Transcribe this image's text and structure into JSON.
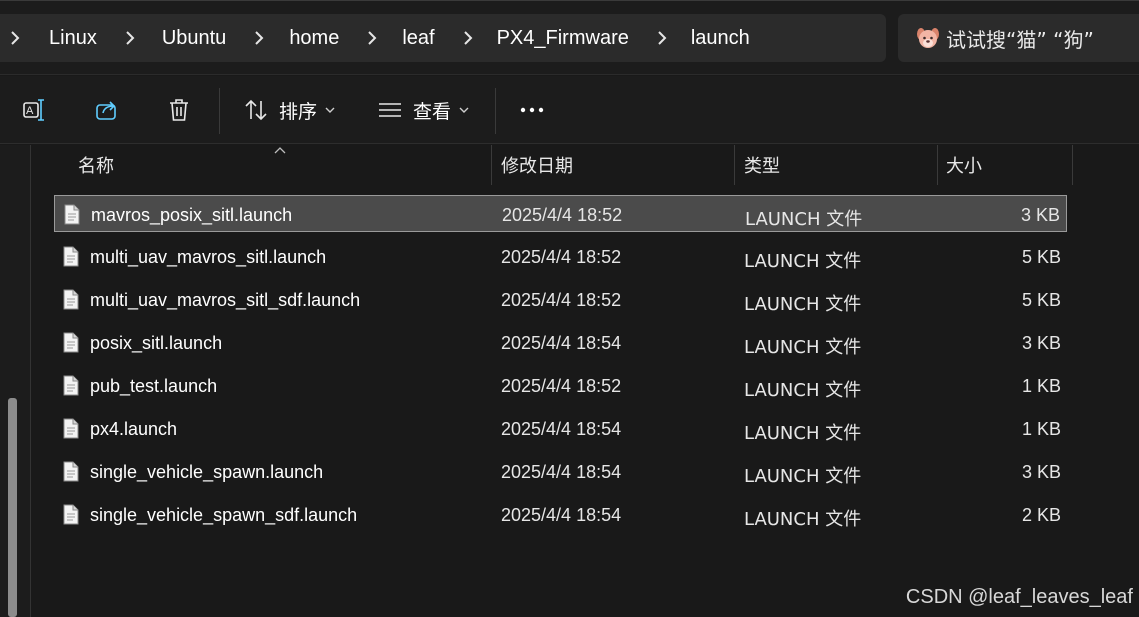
{
  "breadcrumb": {
    "items": [
      "Linux",
      "Ubuntu",
      "home",
      "leaf",
      "PX4_Firmware",
      "launch"
    ]
  },
  "search": {
    "placeholder": "试试搜“猫” “狗”"
  },
  "commandbar": {
    "sort_label": "排序",
    "view_label": "查看",
    "icons": [
      "rename-icon",
      "share-icon",
      "delete-icon",
      "sort-icon",
      "view-icon",
      "more-icon"
    ]
  },
  "columns": {
    "name": "名称",
    "modified": "修改日期",
    "type": "类型",
    "size": "大小"
  },
  "files": [
    {
      "name": "mavros_posix_sitl.launch",
      "modified": "2025/4/4 18:52",
      "type": "LAUNCH 文件",
      "size": "3 KB",
      "selected": true
    },
    {
      "name": "multi_uav_mavros_sitl.launch",
      "modified": "2025/4/4 18:52",
      "type": "LAUNCH 文件",
      "size": "5 KB",
      "selected": false
    },
    {
      "name": "multi_uav_mavros_sitl_sdf.launch",
      "modified": "2025/4/4 18:52",
      "type": "LAUNCH 文件",
      "size": "5 KB",
      "selected": false
    },
    {
      "name": "posix_sitl.launch",
      "modified": "2025/4/4 18:54",
      "type": "LAUNCH 文件",
      "size": "3 KB",
      "selected": false
    },
    {
      "name": "pub_test.launch",
      "modified": "2025/4/4 18:52",
      "type": "LAUNCH 文件",
      "size": "1 KB",
      "selected": false
    },
    {
      "name": "px4.launch",
      "modified": "2025/4/4 18:54",
      "type": "LAUNCH 文件",
      "size": "1 KB",
      "selected": false
    },
    {
      "name": "single_vehicle_spawn.launch",
      "modified": "2025/4/4 18:54",
      "type": "LAUNCH 文件",
      "size": "3 KB",
      "selected": false
    },
    {
      "name": "single_vehicle_spawn_sdf.launch",
      "modified": "2025/4/4 18:54",
      "type": "LAUNCH 文件",
      "size": "2 KB",
      "selected": false
    }
  ],
  "watermark": "CSDN @leaf_leaves_leaf",
  "colors": {
    "background": "#191919",
    "selected_row": "#4b4b4b",
    "selected_border": "#9a9a9a"
  }
}
